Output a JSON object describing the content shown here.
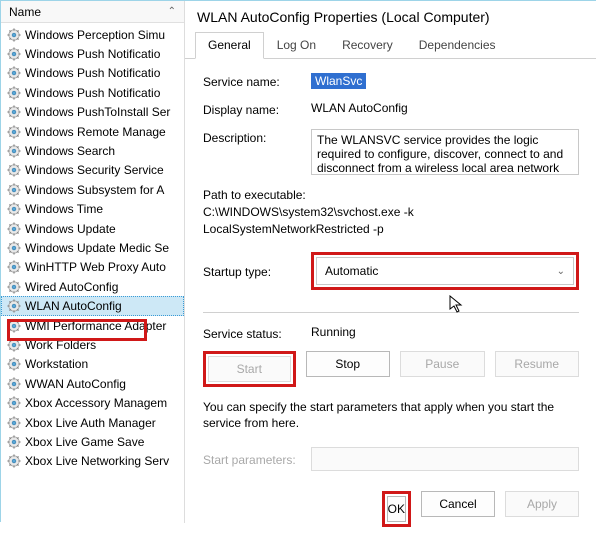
{
  "left": {
    "column_header": "Name",
    "services": [
      "Windows Perception Simu",
      "Windows Push Notificatio",
      "Windows Push Notificatio",
      "Windows Push Notificatio",
      "Windows PushToInstall Ser",
      "Windows Remote Manage",
      "Windows Search",
      "Windows Security Service",
      "Windows Subsystem for A",
      "Windows Time",
      "Windows Update",
      "Windows Update Medic Se",
      "WinHTTP Web Proxy Auto",
      "Wired AutoConfig",
      "WLAN AutoConfig",
      "WMI Performance Adapter",
      "Work Folders",
      "Workstation",
      "WWAN AutoConfig",
      "Xbox Accessory Managem",
      "Xbox Live Auth Manager",
      "Xbox Live Game Save",
      "Xbox Live Networking Serv"
    ]
  },
  "dialog": {
    "title": "WLAN AutoConfig Properties (Local Computer)",
    "tabs": [
      "General",
      "Log On",
      "Recovery",
      "Dependencies"
    ],
    "service_name_label": "Service name:",
    "service_name": "WlanSvc",
    "display_name_label": "Display name:",
    "display_name": "WLAN AutoConfig",
    "description_label": "Description:",
    "description": "The WLANSVC service provides the logic required to configure, discover, connect to and disconnect from a wireless local area network (WLAN) as",
    "path_label": "Path to executable:",
    "path": "C:\\WINDOWS\\system32\\svchost.exe -k LocalSystemNetworkRestricted -p",
    "startup_label": "Startup type:",
    "startup_value": "Automatic",
    "status_label": "Service status:",
    "status_value": "Running",
    "buttons": {
      "start": "Start",
      "stop": "Stop",
      "pause": "Pause",
      "resume": "Resume"
    },
    "hint": "You can specify the start parameters that apply when you start the service from here.",
    "params_label": "Start parameters:",
    "params_value": "",
    "footer": {
      "ok": "OK",
      "cancel": "Cancel",
      "apply": "Apply"
    }
  }
}
